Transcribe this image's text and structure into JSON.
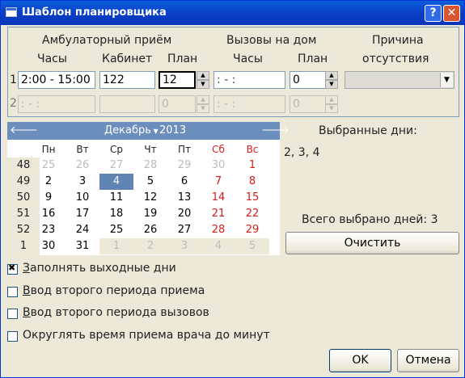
{
  "window": {
    "title": "Шаблон планировщика",
    "help_label": "?",
    "close_label": "✕"
  },
  "headers": {
    "ambulatory": "Амбулаторный приём",
    "hours": "Часы",
    "cabinet": "Кабинет",
    "plan": "План",
    "home_calls": "Вызовы на дом",
    "calls_hours": "Часы",
    "calls_plan": "План",
    "absence_line1": "Причина",
    "absence_line2": "отсутствия"
  },
  "row1": {
    "num": "1",
    "hours": "2:00 - 15:00",
    "cabinet": "122",
    "plan": "12",
    "calls_hours": "  :   -   :",
    "calls_plan": "0",
    "absence": ""
  },
  "row2": {
    "num": "2",
    "hours": "  :   -   :",
    "cabinet": "",
    "plan": "0",
    "calls_hours": "  :   -   :",
    "calls_plan": "0"
  },
  "calendar": {
    "prev_label": "🡐",
    "next_label": "🡒",
    "month": "Декабрь",
    "year": "2013",
    "weekdays": [
      "Пн",
      "Вт",
      "Ср",
      "Чт",
      "Пт",
      "Сб",
      "Вс"
    ],
    "weeks": [
      {
        "num": "48",
        "days": [
          [
            "25",
            "other"
          ],
          [
            "26",
            "other"
          ],
          [
            "27",
            "other"
          ],
          [
            "28",
            "other"
          ],
          [
            "29",
            "other"
          ],
          [
            "30",
            "other"
          ],
          [
            "1",
            "weekend"
          ]
        ]
      },
      {
        "num": "49",
        "days": [
          [
            "2",
            ""
          ],
          [
            "3",
            ""
          ],
          [
            "4",
            "selected"
          ],
          [
            "5",
            ""
          ],
          [
            "6",
            ""
          ],
          [
            "7",
            "weekend"
          ],
          [
            "8",
            "weekend"
          ]
        ]
      },
      {
        "num": "50",
        "days": [
          [
            "9",
            ""
          ],
          [
            "10",
            ""
          ],
          [
            "11",
            ""
          ],
          [
            "12",
            ""
          ],
          [
            "13",
            ""
          ],
          [
            "14",
            "weekend"
          ],
          [
            "15",
            "weekend"
          ]
        ]
      },
      {
        "num": "51",
        "days": [
          [
            "16",
            ""
          ],
          [
            "17",
            ""
          ],
          [
            "18",
            ""
          ],
          [
            "19",
            ""
          ],
          [
            "20",
            ""
          ],
          [
            "21",
            "weekend"
          ],
          [
            "22",
            "weekend"
          ]
        ]
      },
      {
        "num": "52",
        "days": [
          [
            "23",
            ""
          ],
          [
            "24",
            ""
          ],
          [
            "25",
            ""
          ],
          [
            "26",
            ""
          ],
          [
            "27",
            ""
          ],
          [
            "28",
            "weekend"
          ],
          [
            "29",
            "weekend"
          ]
        ]
      },
      {
        "num": "1",
        "days": [
          [
            "30",
            ""
          ],
          [
            "31",
            ""
          ],
          [
            "1",
            "other"
          ],
          [
            "2",
            "other"
          ],
          [
            "3",
            "other"
          ],
          [
            "4",
            "other"
          ],
          [
            "5",
            "other"
          ]
        ]
      }
    ]
  },
  "selection": {
    "label": "Выбранные дни:",
    "days": "2, 3, 4",
    "total": "Всего выбрано дней: 3",
    "clear_label": "Очистить"
  },
  "options": [
    {
      "key": "З",
      "rest": "аполнять выходные дни",
      "checked": true
    },
    {
      "key": "В",
      "rest": "вод второго периода приема",
      "checked": false
    },
    {
      "key": "В",
      "rest": "вод второго периода вызовов",
      "checked": false
    },
    {
      "key": "",
      "rest": "Округлять время приема врача до минут",
      "checked": false
    }
  ],
  "footer": {
    "ok_label": "OK",
    "cancel_label": "Отмена"
  }
}
